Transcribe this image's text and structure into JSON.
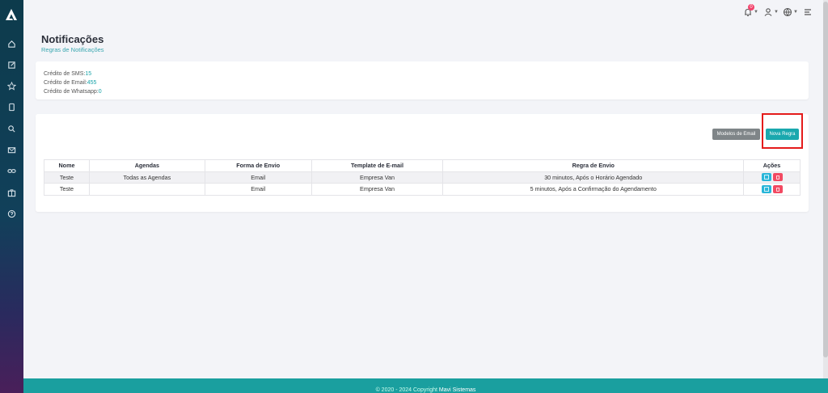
{
  "header": {
    "notification_count": "0"
  },
  "page": {
    "title": "Notificações",
    "subtitle": "Regras de Notificações"
  },
  "credits": {
    "sms_label": "Crédito de SMS:",
    "sms_value": "15",
    "email_label": "Crédito de Email:",
    "email_value": "455",
    "whatsapp_label": "Crédito de Whatsapp:",
    "whatsapp_value": "0"
  },
  "toolbar": {
    "email_templates_label": "Modelos de Email",
    "new_rule_label": "Nova Regra"
  },
  "table": {
    "headers": [
      "Nome",
      "Agendas",
      "Forma de Envio",
      "Template de E-mail",
      "Regra de Envio",
      "Ações"
    ],
    "rows": [
      {
        "nome": "Teste",
        "agendas": "Todas as Agendas",
        "forma": "Email",
        "template": "Empresa Van",
        "regra": "30 minutos, Após o Horário Agendado"
      },
      {
        "nome": "Teste",
        "agendas": "",
        "forma": "Email",
        "template": "Empresa Van",
        "regra": "5 minutos, Após a Confirmação do Agendamento"
      }
    ]
  },
  "footer": {
    "copyright": "© 2020 - 2024 Copyright",
    "company": "Mavi Sistemas"
  },
  "colors": {
    "accent": "#1aa8ae",
    "highlight": "#e41b1b",
    "delete": "#f24a62",
    "edit": "#29b6d9"
  }
}
